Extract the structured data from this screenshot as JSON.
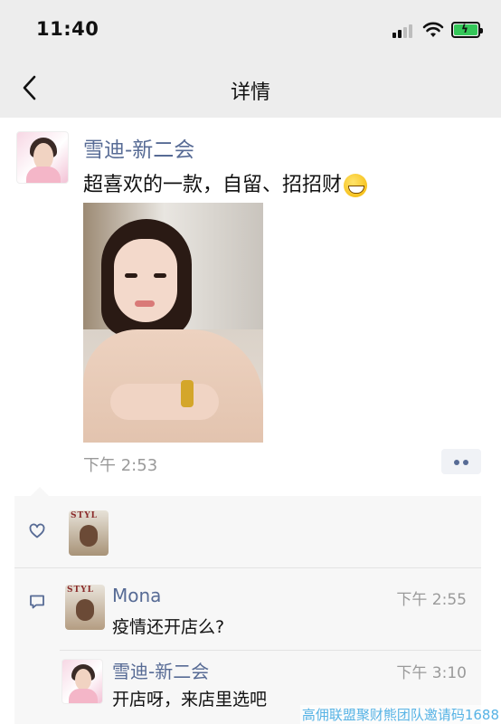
{
  "status_bar": {
    "time": "11:40",
    "signal_icon": "cellular-signal-icon",
    "wifi_icon": "wifi-icon",
    "battery_icon": "battery-charging-icon",
    "battery_color": "#34c759"
  },
  "nav": {
    "back_icon": "chevron-left-icon",
    "title": "详情"
  },
  "post": {
    "author": "雪迪-新二会",
    "text": "超喜欢的一款，自留、招招财",
    "emoji_icon": "grinning-face-emoji-icon",
    "photo_icon": "selfie-photo",
    "time": "下午 2:53",
    "more_icon": "two-dots-more-icon"
  },
  "likes": {
    "icon": "heart-outline-icon",
    "avatar_text": "STYL"
  },
  "comments": [
    {
      "name": "Mona",
      "time": "下午 2:55",
      "text": "疫情还开店么?",
      "avatar_text": "STYL"
    },
    {
      "name": "雪迪-新二会",
      "time": "下午 3:10",
      "text": "开店呀，来店里选吧"
    }
  ],
  "comment_icon": "comment-bubble-icon",
  "watermark": "高佣联盟聚财熊团队邀请码1688",
  "colors": {
    "link_blue": "#576b95",
    "timestamp_gray": "#9a9a9a",
    "nav_bg": "#ededed",
    "interaction_bg": "#f7f7f7"
  }
}
